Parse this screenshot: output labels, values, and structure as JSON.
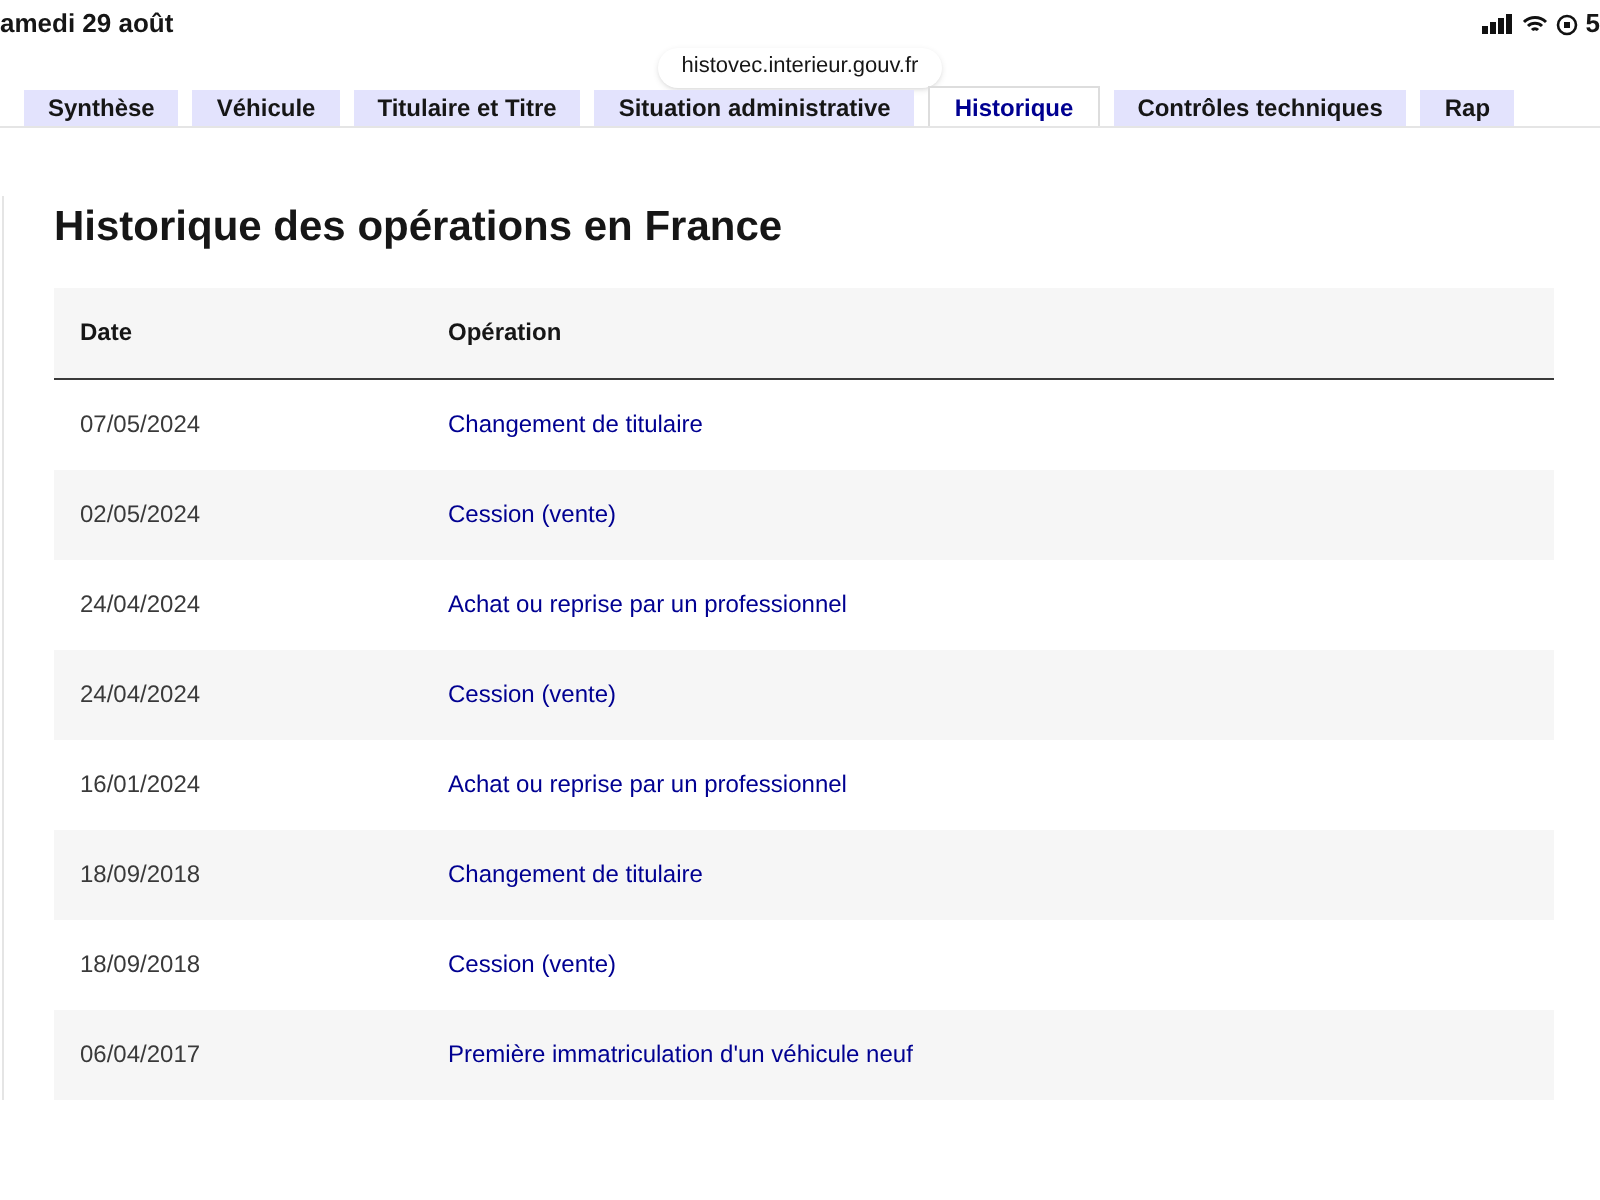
{
  "status_bar": {
    "date": "amedi 29 août",
    "battery": "5"
  },
  "address_bar": {
    "url": "histovec.interieur.gouv.fr"
  },
  "tabs": [
    {
      "label": "Synthèse",
      "selected": false
    },
    {
      "label": "Véhicule",
      "selected": false
    },
    {
      "label": "Titulaire et Titre",
      "selected": false
    },
    {
      "label": "Situation administrative",
      "selected": false
    },
    {
      "label": "Historique",
      "selected": true
    },
    {
      "label": "Contrôles techniques",
      "selected": false
    },
    {
      "label": "Rap",
      "selected": false
    }
  ],
  "section": {
    "title": "Historique des opérations en France"
  },
  "table": {
    "columns": [
      "Date",
      "Opération"
    ],
    "rows": [
      {
        "date": "07/05/2024",
        "operation": "Changement de titulaire"
      },
      {
        "date": "02/05/2024",
        "operation": "Cession (vente)"
      },
      {
        "date": "24/04/2024",
        "operation": "Achat ou reprise par un professionnel"
      },
      {
        "date": "24/04/2024",
        "operation": "Cession (vente)"
      },
      {
        "date": "16/01/2024",
        "operation": "Achat ou reprise par un professionnel"
      },
      {
        "date": "18/09/2018",
        "operation": "Changement de titulaire"
      },
      {
        "date": "18/09/2018",
        "operation": "Cession (vente)"
      },
      {
        "date": "06/04/2017",
        "operation": "Première immatriculation d'un véhicule neuf"
      }
    ]
  }
}
